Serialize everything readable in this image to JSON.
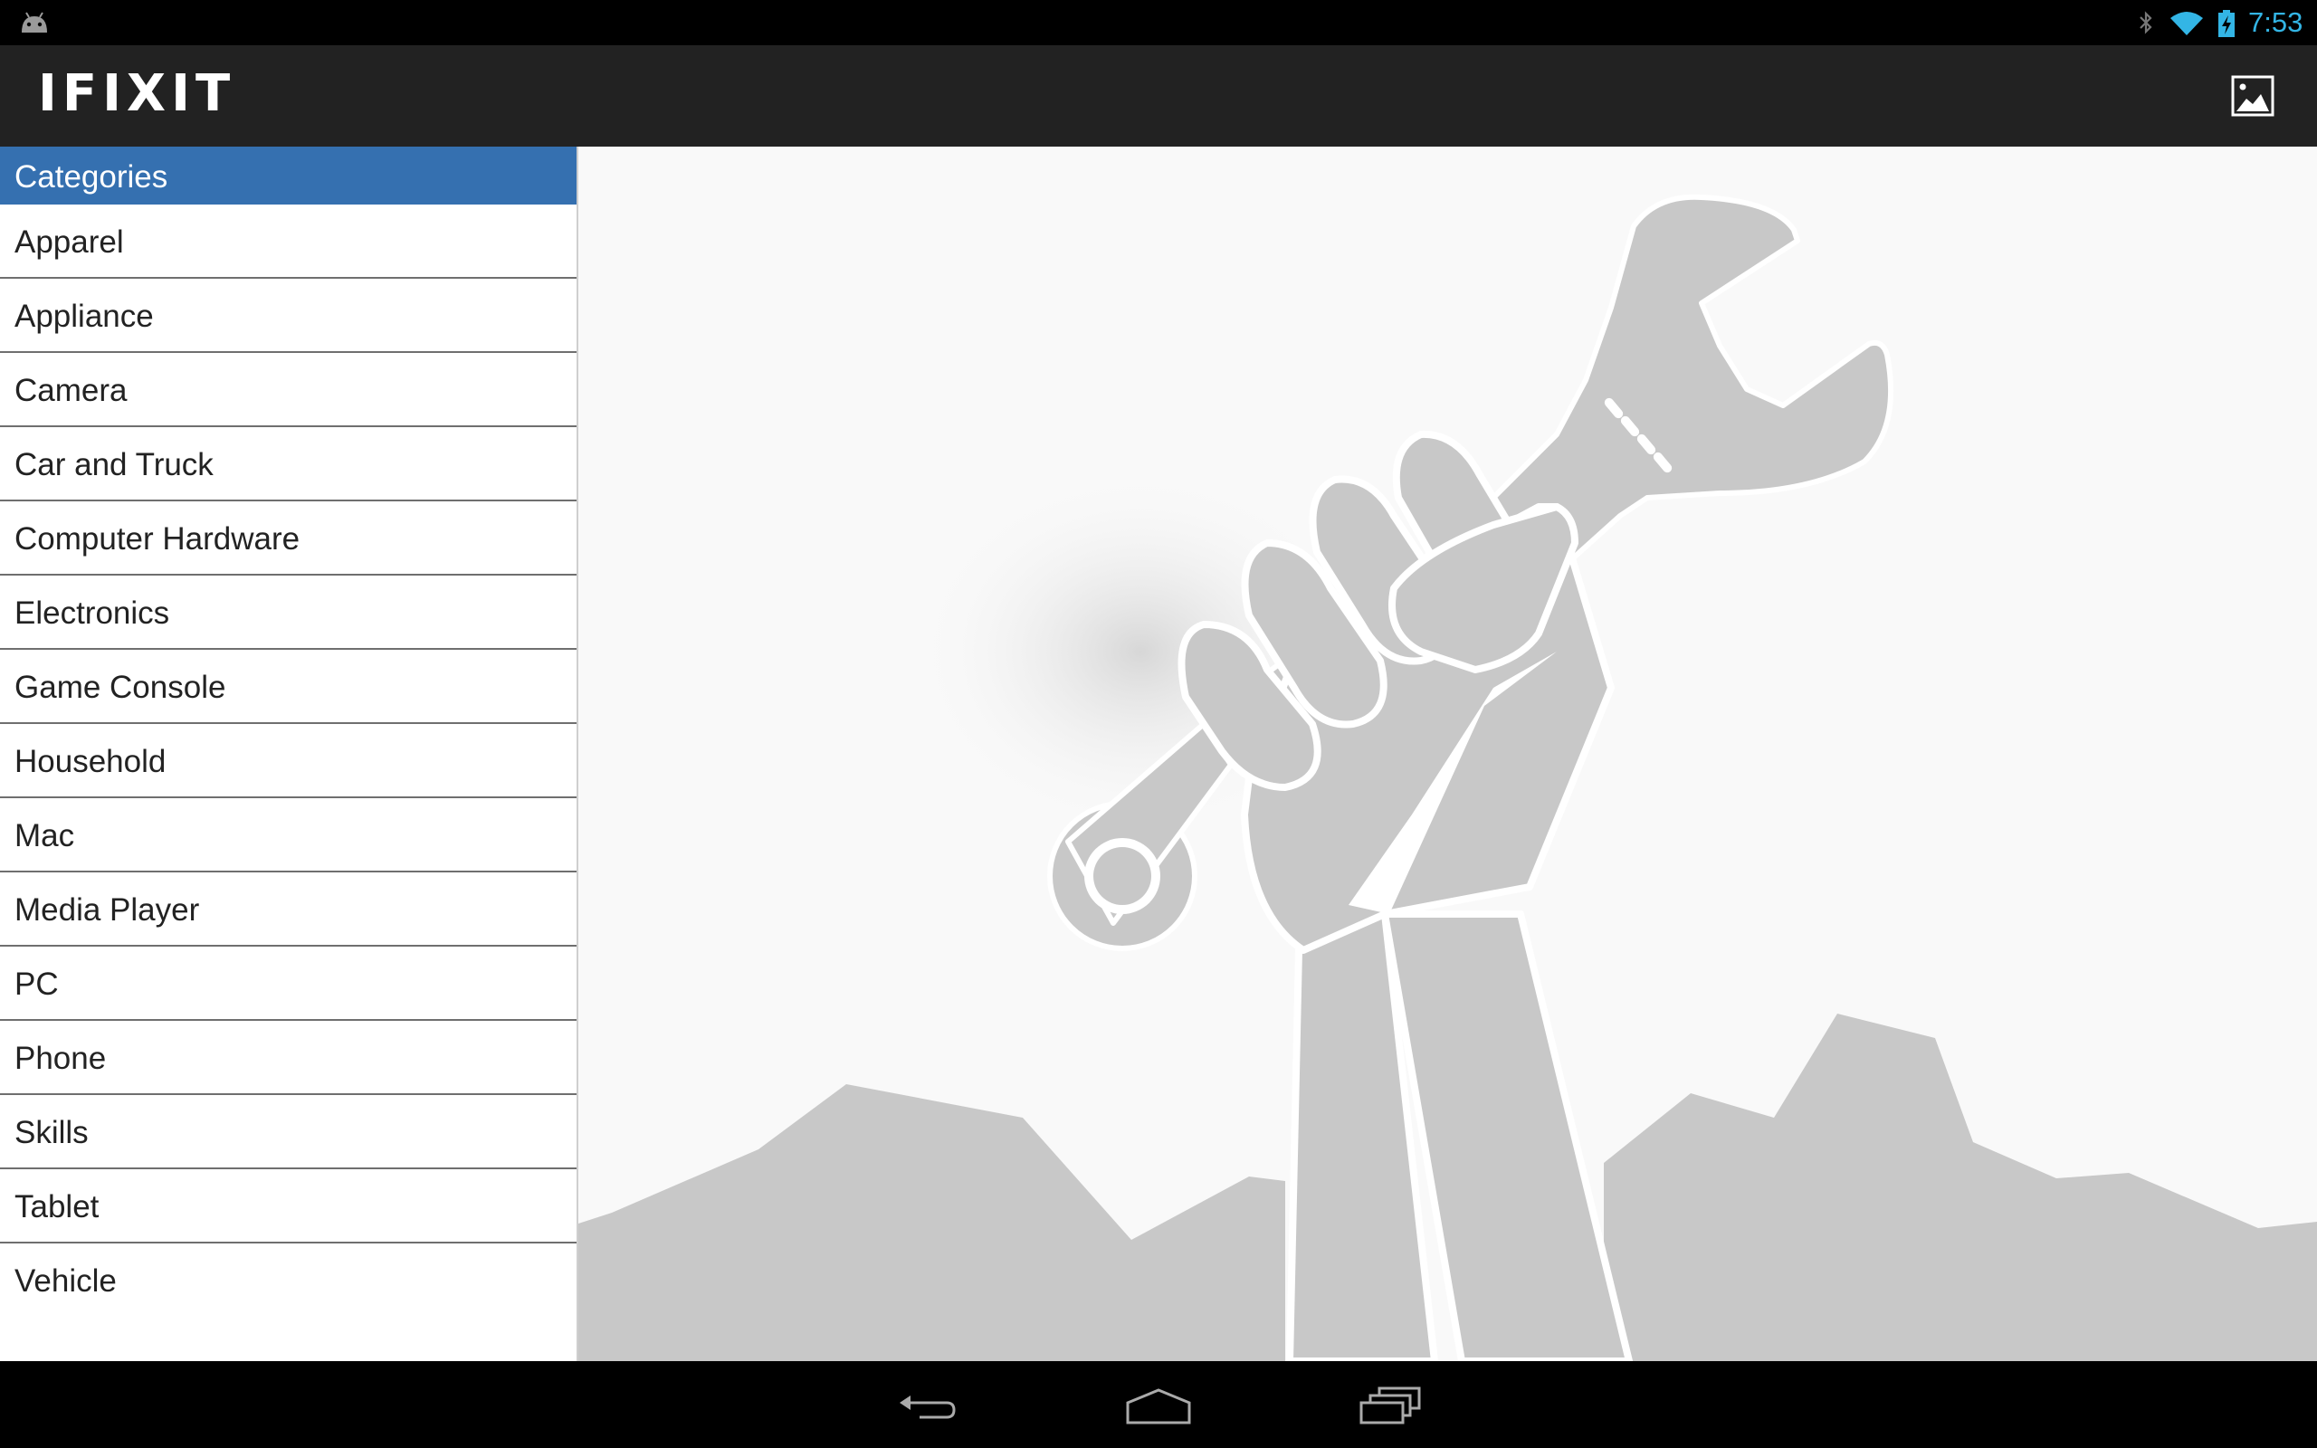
{
  "status_bar": {
    "time": "7:53",
    "time_color": "#33b5e5",
    "icons": [
      "android-icon",
      "bluetooth-icon",
      "wifi-icon",
      "battery-charging-icon"
    ]
  },
  "action_bar": {
    "logo_text": "IFIXIT",
    "background": "#222222",
    "action_icon": "image-icon"
  },
  "sidebar": {
    "header": "Categories",
    "header_color": "#3570b0",
    "items": [
      {
        "label": "Apparel"
      },
      {
        "label": "Appliance"
      },
      {
        "label": "Camera"
      },
      {
        "label": "Car and Truck"
      },
      {
        "label": "Computer Hardware"
      },
      {
        "label": "Electronics"
      },
      {
        "label": "Game Console"
      },
      {
        "label": "Household"
      },
      {
        "label": "Mac"
      },
      {
        "label": "Media Player"
      },
      {
        "label": "PC"
      },
      {
        "label": "Phone"
      },
      {
        "label": "Skills"
      },
      {
        "label": "Tablet"
      },
      {
        "label": "Vehicle"
      }
    ]
  },
  "hero": {
    "illustration": "fist-holding-wrench-illustration",
    "fill_color": "#c8c8c8"
  },
  "nav_bar": {
    "icons": [
      "back-icon",
      "home-icon",
      "recent-apps-icon"
    ]
  }
}
